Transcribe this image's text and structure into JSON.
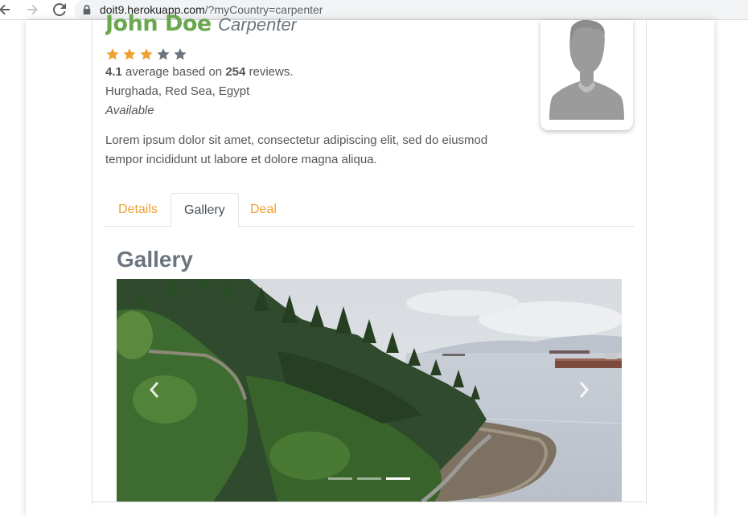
{
  "browser": {
    "url_host": "doit9.herokuapp.com",
    "url_path": "/?myCountry=carpenter"
  },
  "profile": {
    "name": "John Doe",
    "profession": "Carpenter",
    "rating_stars_filled": 3,
    "rating_stars_total": 5,
    "rating_value": "4.1",
    "reviews_text_1": "average based on",
    "reviews_count": "254",
    "reviews_text_2": "reviews.",
    "location": "Hurghada, Red Sea, Egypt",
    "availability": "Available",
    "bio": "Lorem ipsum dolor sit amet, consectetur adipiscing elit, sed do eiusmod tempor incididunt ut labore et dolore magna aliqua."
  },
  "tabs": [
    {
      "label": "Details",
      "active": false
    },
    {
      "label": "Gallery",
      "active": true
    },
    {
      "label": "Deal",
      "active": false
    }
  ],
  "gallery": {
    "title": "Gallery",
    "slide_count": 3,
    "active_slide": 3
  },
  "colors": {
    "name_green": "#6aa84f",
    "tab_orange": "#f0a030",
    "star_on": "#f0a030",
    "star_off": "#6c757d"
  },
  "icons": {
    "back": "arrow-left-icon",
    "forward": "arrow-right-icon",
    "reload": "reload-icon",
    "lock": "lock-icon",
    "prev": "chevron-left-icon",
    "next": "chevron-right-icon",
    "star": "star-icon",
    "avatar": "user-silhouette-icon"
  }
}
